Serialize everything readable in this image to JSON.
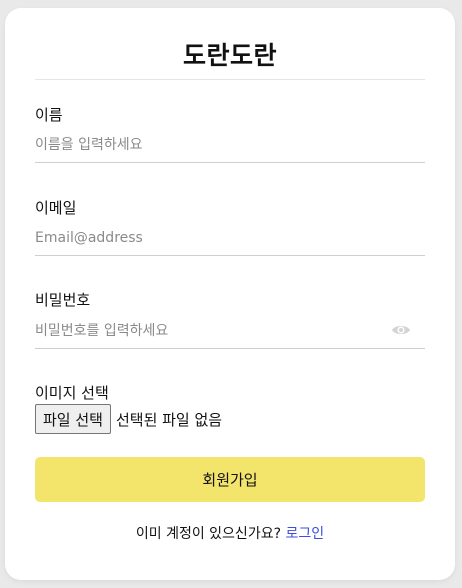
{
  "header": {
    "title": "도란도란"
  },
  "form": {
    "name": {
      "label": "이름",
      "placeholder": "이름을 입력하세요"
    },
    "email": {
      "label": "이메일",
      "placeholder": "Email@address"
    },
    "password": {
      "label": "비밀번호",
      "placeholder": "비밀번호를 입력하세요",
      "toggle_icon": "eye-icon"
    },
    "image": {
      "label": "이미지 선택",
      "button_label": "파일 선택",
      "status": "선택된 파일 없음"
    },
    "submit_label": "회원가입"
  },
  "footer": {
    "prompt": "이미 계정이 있으신가요?",
    "login_link": "로그인"
  },
  "colors": {
    "accent": "#f3e46c",
    "link": "#3b4ee0",
    "background": "#e9e9e9"
  }
}
